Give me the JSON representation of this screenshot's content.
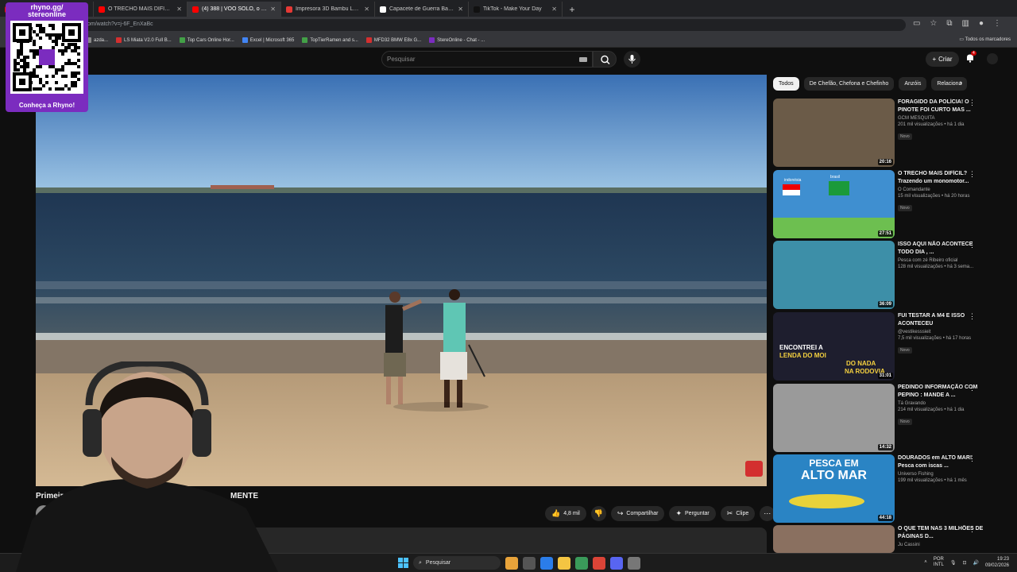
{
  "browser": {
    "tabs": [
      {
        "title": "n",
        "color": "#ff0000",
        "active": false
      },
      {
        "title": "O TRECHO MAIS DIFÍCIL? Trazen",
        "color": "#ff0000",
        "active": false
      },
      {
        "title": "(4) 388 | VOO SOLO, o dia que",
        "color": "#ff0000",
        "active": true
      },
      {
        "title": "Impresora 3D Bambu Lab P2S",
        "color": "#e53935",
        "active": false
      },
      {
        "title": "Capacete de Guerra Battle Cat",
        "color": "#ffffff",
        "active": false
      },
      {
        "title": "TikTok - Make Your Day",
        "color": "#111111",
        "active": false
      }
    ],
    "url": "om/watch?v=j-6F_EnXaBc",
    "bookmarks": [
      {
        "label": "azda...",
        "color": "#888888"
      },
      {
        "label": "LS Miata V2.0 Full B...",
        "color": "#d32f2f"
      },
      {
        "label": "Top Cars Online Hor...",
        "color": "#43a047"
      },
      {
        "label": "Excel | Microsoft 365",
        "color": "#4285f4"
      },
      {
        "label": "TopTierRamen and s...",
        "color": "#43a047"
      },
      {
        "label": "MFD32 BMW E8x G...",
        "color": "#d32f2f"
      },
      {
        "label": "StereOnline - Chat - ...",
        "color": "#7b2cbf"
      }
    ],
    "bookmarks_right": "Todos os marcadores"
  },
  "youtube": {
    "search_placeholder": "Pesquisar",
    "create_label": "Criar",
    "notifications_count": "4",
    "video_title_left": "Primeira Pe",
    "video_title_right": "MENTE",
    "actions": {
      "like_count": "4,8 mil",
      "share": "Compartilhar",
      "ask": "Perguntar",
      "clip": "Clipe"
    },
    "chips": [
      "Todos",
      "De Chefão, Chefona e Chefinho",
      "Anzóis",
      "Relaciona"
    ],
    "recommendations": [
      {
        "title": "FORAGIDO DA POLÍCIA! O PINOTE FOI CURTO MAS ...",
        "channel": "GCM MESQUITA",
        "meta": "201 mil visualizações • há 1 dia",
        "badge": "Novo",
        "duration": "20:16",
        "thumb": "#6b5b48"
      },
      {
        "title": "O TRECHO MAIS DIFÍCIL? Trazendo um monomotor...",
        "channel": "O Comandante",
        "meta": "15 mil visualizações • há 20 horas",
        "badge": "Novo",
        "duration": "27:51",
        "thumb": "#3f8fd0"
      },
      {
        "title": "ISSO AQUI NÃO ACONTECE TODO DIA , ...",
        "channel": "Pesca com zé Ribeiro oficial",
        "meta": "128 mil visualizações • há 3 sema...",
        "badge": "",
        "duration": "36:09",
        "thumb": "#3d8fa8"
      },
      {
        "title": "FUI TESTAR A M4 E ISSO ACONTECEU",
        "channel": "@vestikesssieit",
        "meta": "7,5 mil visualizações • há 17 horas",
        "badge": "Novo",
        "duration": "31:01",
        "thumb": "#1e1e2e"
      },
      {
        "title": "PEDINDO INFORMAÇÃO COM PEPINO : MANDE A ...",
        "channel": "Tá Gravando",
        "meta": "214 mil visualizações • há 1 dia",
        "badge": "Novo",
        "duration": "14:32",
        "thumb": "#9a9a9a"
      },
      {
        "title": "DOURADOS em ALTO MAR! Pesca com iscas ...",
        "channel": "Universo Fishing",
        "meta": "199 mil visualizações • há 1 mês",
        "badge": "",
        "duration": "44:18",
        "thumb": "#2a84c4"
      },
      {
        "title": "O QUE TEM NAS 3 MILHÕES DE PÁGINAS D...",
        "channel": "Ju Cassini",
        "meta": "",
        "badge": "",
        "duration": "",
        "thumb": "#8a7060"
      }
    ],
    "thumb_texts": {
      "t2_flag_left": "indonésia",
      "t2_flag_right": "brasil",
      "t4_line1": "ENCONTREI A",
      "t4_line2": "LENDA DO MOI",
      "t4_line3": "DO NADA",
      "t4_line4": "NA RODOVIA",
      "t6_line1": "PESCA EM",
      "t6_line2": "ALTO MAR"
    }
  },
  "taskbar": {
    "search_placeholder": "Pesquisar",
    "lang_line1": "POR",
    "lang_line2": "INTL",
    "time": "19:23",
    "date": "09/02/2026"
  },
  "overlay": {
    "line1": "rhyno.gg/",
    "line2": "stereonline",
    "cta": "Conheça a Rhyno!"
  }
}
